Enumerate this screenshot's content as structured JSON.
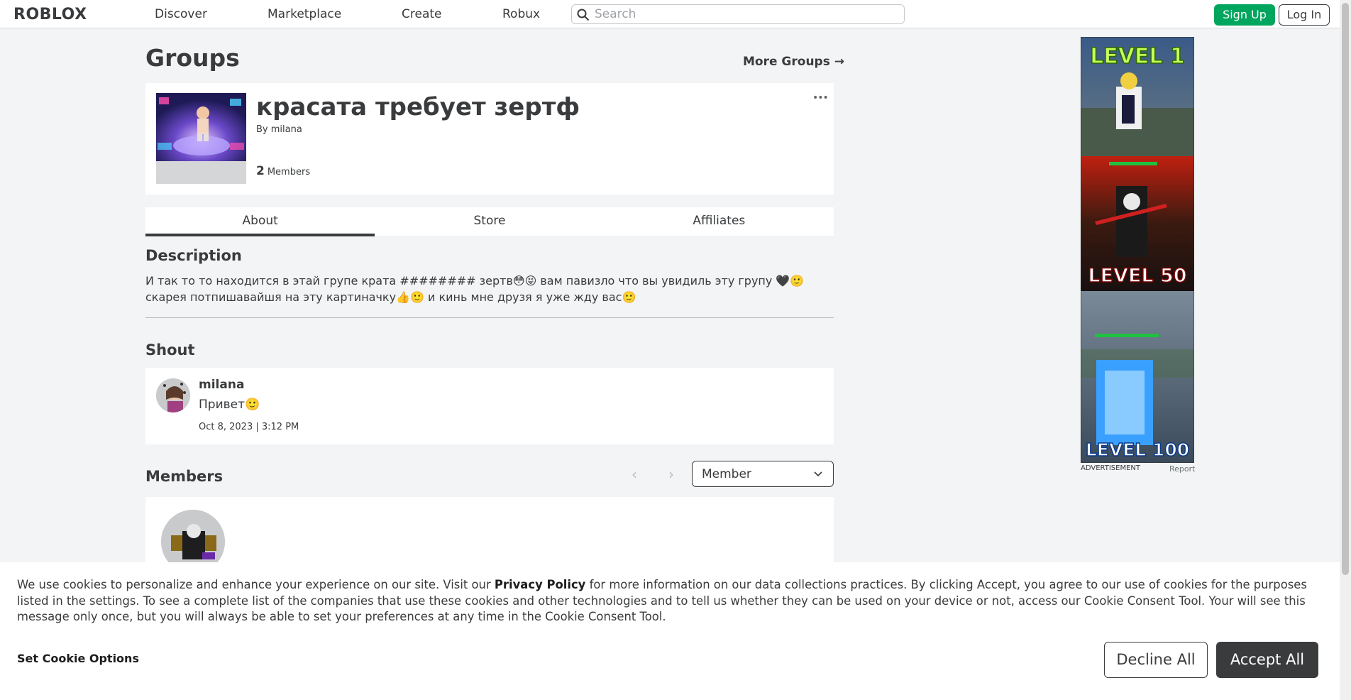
{
  "nav": {
    "logo": "ROBLOX",
    "links": [
      "Discover",
      "Marketplace",
      "Create",
      "Robux"
    ],
    "search_placeholder": "Search",
    "signup": "Sign Up",
    "login": "Log In"
  },
  "page": {
    "title": "Groups",
    "more_groups": "More Groups →"
  },
  "group": {
    "name": "красата требует зертф",
    "owner_prefix": "By",
    "owner": "milana",
    "member_count": "2",
    "member_label": "Members",
    "menu": "•••"
  },
  "tabs": [
    "About",
    "Store",
    "Affiliates"
  ],
  "description": {
    "title": "Description",
    "text": "И так то то находится в этай групе крата ######## зертв😳😝 вам павизло что вы увидиль эту групу 🖤🙂 скарея потпишавайшя на эту картиначку👍🙂 и кинь мне друзя я уже жду вас🙂"
  },
  "shout": {
    "title": "Shout",
    "user": "milana",
    "message": "Привет🙂",
    "date": "Oct 8, 2023 | 3:12 PM"
  },
  "members": {
    "title": "Members",
    "prev": "‹",
    "next": "›",
    "role": "Member"
  },
  "ad": {
    "label": "ADVERTISEMENT",
    "report": "Report",
    "panels": [
      "LEVEL 1",
      "LEVEL 50",
      "LEVEL 100"
    ]
  },
  "cookie": {
    "text_before": "We use cookies to personalize and enhance your experience on our site. Visit our ",
    "policy_link": "Privacy Policy",
    "text_after": " for more information on our data collections practices. By clicking Accept, you agree to our use of cookies for the purposes listed in the settings. To see a complete list of the companies that use these cookies and other technologies and to tell us whether they can be used on your device or not, access our Cookie Consent Tool. Your will see this message only once, but you will always be able to set your preferences at any time in the Cookie Consent Tool.",
    "options": "Set Cookie Options",
    "decline": "Decline All",
    "accept": "Accept All"
  }
}
